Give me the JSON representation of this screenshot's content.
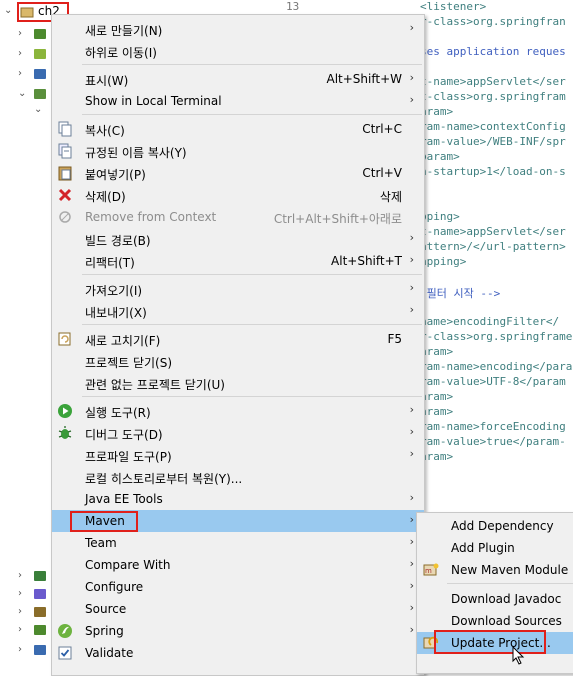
{
  "tree": {
    "root_label": "ch2",
    "rows": 10
  },
  "editor": {
    "line_number": "13",
    "lines": [
      {
        "text": "<listener>",
        "cls": "tag"
      },
      {
        "text": "r-class>org.springfran",
        "cls": "attr"
      },
      {
        "text": "",
        "cls": "txt"
      },
      {
        "text": "ses application reques",
        "cls": "cmt"
      },
      {
        "text": "",
        "cls": "txt"
      },
      {
        "text": "t-name>appServlet</ser",
        "cls": "attr"
      },
      {
        "text": "t-class>org.springfram",
        "cls": "attr"
      },
      {
        "text": "aram>",
        "cls": "tag"
      },
      {
        "text": "ram-name>contextConfig",
        "cls": "attr"
      },
      {
        "text": "ram-value>/WEB-INF/spr",
        "cls": "attr"
      },
      {
        "text": "param>",
        "cls": "tag"
      },
      {
        "text": "n-startup>1</load-on-s",
        "cls": "attr"
      },
      {
        "text": "",
        "cls": "txt"
      },
      {
        "text": "",
        "cls": "txt"
      },
      {
        "text": "pping>",
        "cls": "tag"
      },
      {
        "text": "t-name>appServlet</ser",
        "cls": "attr"
      },
      {
        "text": "attern>/</url-pattern>",
        "cls": "attr"
      },
      {
        "text": "apping>",
        "cls": "tag"
      },
      {
        "text": "",
        "cls": "txt"
      },
      {
        "text": " 필터 시작 -->",
        "cls": "cmt"
      },
      {
        "text": "",
        "cls": "txt"
      },
      {
        "text": "name>encodingFilter</",
        "cls": "attr"
      },
      {
        "text": "r-class>org.springframe",
        "cls": "attr"
      },
      {
        "text": "aram>",
        "cls": "tag"
      },
      {
        "text": "ram-name>encoding</para",
        "cls": "attr"
      },
      {
        "text": "ram-value>UTF-8</param",
        "cls": "attr"
      },
      {
        "text": "aram>",
        "cls": "tag"
      },
      {
        "text": "aram>",
        "cls": "tag"
      },
      {
        "text": "ram-name>forceEncoding",
        "cls": "attr"
      },
      {
        "text": "ram-value>true</param-",
        "cls": "attr"
      },
      {
        "text": "aram>",
        "cls": "tag"
      }
    ]
  },
  "menu": {
    "items": [
      {
        "label": "새로 만들기(N)",
        "shortcut": "",
        "submenu": true,
        "icon": ""
      },
      {
        "label": "하위로 이동(I)",
        "shortcut": "",
        "submenu": false,
        "icon": ""
      },
      {
        "sep": true
      },
      {
        "label": "표시(W)",
        "shortcut": "Alt+Shift+W",
        "submenu": true,
        "icon": ""
      },
      {
        "label": "Show in Local Terminal",
        "shortcut": "",
        "submenu": true,
        "icon": ""
      },
      {
        "sep": true
      },
      {
        "label": "복사(C)",
        "shortcut": "Ctrl+C",
        "submenu": false,
        "icon": "copy-icon"
      },
      {
        "label": "규정된 이름 복사(Y)",
        "shortcut": "",
        "submenu": false,
        "icon": "copy-qualified-icon"
      },
      {
        "label": "붙여넣기(P)",
        "shortcut": "Ctrl+V",
        "submenu": false,
        "icon": "paste-icon"
      },
      {
        "label": "삭제(D)",
        "shortcut": "삭제",
        "submenu": false,
        "icon": "delete-icon"
      },
      {
        "label": "Remove from Context",
        "shortcut": "Ctrl+Alt+Shift+아래로",
        "submenu": false,
        "icon": "remove-context-icon",
        "disabled": true
      },
      {
        "label": "빌드 경로(B)",
        "shortcut": "",
        "submenu": true,
        "icon": ""
      },
      {
        "label": "리팩터(T)",
        "shortcut": "Alt+Shift+T",
        "submenu": true,
        "icon": ""
      },
      {
        "sep": true
      },
      {
        "label": "가져오기(I)",
        "shortcut": "",
        "submenu": true,
        "icon": ""
      },
      {
        "label": "내보내기(X)",
        "shortcut": "",
        "submenu": true,
        "icon": ""
      },
      {
        "sep": true
      },
      {
        "label": "새로 고치기(F)",
        "shortcut": "F5",
        "submenu": false,
        "icon": "refresh-icon"
      },
      {
        "label": "프로젝트 닫기(S)",
        "shortcut": "",
        "submenu": false,
        "icon": ""
      },
      {
        "label": "관련 없는 프로젝트 닫기(U)",
        "shortcut": "",
        "submenu": false,
        "icon": ""
      },
      {
        "sep": true
      },
      {
        "label": "실행 도구(R)",
        "shortcut": "",
        "submenu": true,
        "icon": "run-icon"
      },
      {
        "label": "디버그 도구(D)",
        "shortcut": "",
        "submenu": true,
        "icon": "debug-icon"
      },
      {
        "label": "프로파일 도구(P)",
        "shortcut": "",
        "submenu": true,
        "icon": ""
      },
      {
        "label": "로컬 히스토리로부터 복원(Y)...",
        "shortcut": "",
        "submenu": false,
        "icon": ""
      },
      {
        "label": "Java EE Tools",
        "shortcut": "",
        "submenu": true,
        "icon": ""
      },
      {
        "label": "Maven",
        "shortcut": "",
        "submenu": true,
        "icon": "",
        "highlight": true
      },
      {
        "label": "Team",
        "shortcut": "",
        "submenu": true,
        "icon": ""
      },
      {
        "label": "Compare With",
        "shortcut": "",
        "submenu": true,
        "icon": ""
      },
      {
        "label": "Configure",
        "shortcut": "",
        "submenu": true,
        "icon": ""
      },
      {
        "label": "Source",
        "shortcut": "",
        "submenu": true,
        "icon": ""
      },
      {
        "label": "Spring",
        "shortcut": "",
        "submenu": true,
        "icon": "spring-icon"
      },
      {
        "label": "Validate",
        "shortcut": "",
        "submenu": false,
        "icon": "checkbox-icon"
      }
    ]
  },
  "submenu": {
    "items": [
      {
        "label": "Add Dependency",
        "icon": ""
      },
      {
        "label": "Add Plugin",
        "icon": ""
      },
      {
        "label": "New Maven Module Pr",
        "icon": "maven-module-icon"
      },
      {
        "sep": true
      },
      {
        "label": "Download Javadoc",
        "icon": ""
      },
      {
        "label": "Download Sources",
        "icon": ""
      },
      {
        "label": "Update Project...",
        "icon": "update-project-icon",
        "highlight": true
      }
    ]
  },
  "colors": {
    "menu_bg": "#f0f0f0",
    "highlight": "#99c9ef",
    "red_box": "#e0201b"
  }
}
